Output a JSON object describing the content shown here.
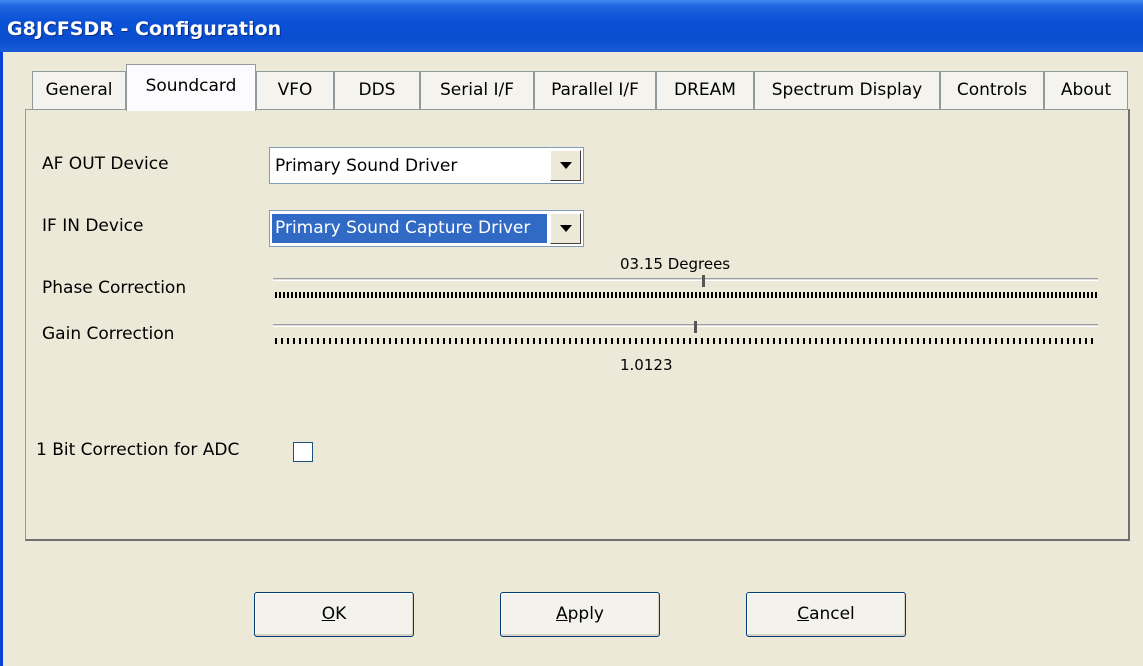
{
  "window": {
    "title": "G8JCFSDR - Configuration"
  },
  "tabs": [
    {
      "label": "General"
    },
    {
      "label": "Soundcard"
    },
    {
      "label": "VFO"
    },
    {
      "label": "DDS"
    },
    {
      "label": "Serial I/F"
    },
    {
      "label": "Parallel I/F"
    },
    {
      "label": "DREAM"
    },
    {
      "label": "Spectrum Display"
    },
    {
      "label": "Controls"
    },
    {
      "label": "About"
    }
  ],
  "active_tab": "Soundcard",
  "soundcard": {
    "af_out": {
      "label": "AF OUT Device",
      "value": "Primary Sound Driver"
    },
    "if_in": {
      "label": "IF IN Device",
      "value": "Primary Sound Capture Driver"
    },
    "phase": {
      "label": "Phase Correction",
      "readout": "03.15 Degrees",
      "position_fraction": 0.52
    },
    "gain": {
      "label": "Gain Correction",
      "readout": "1.0123",
      "position_fraction": 0.51
    },
    "one_bit": {
      "label": "1 Bit Correction for ADC",
      "checked": false
    }
  },
  "buttons": {
    "ok": {
      "mnemonic": "O",
      "rest": "K"
    },
    "apply": {
      "mnemonic": "A",
      "rest": "pply"
    },
    "cancel": {
      "mnemonic": "C",
      "rest": "ancel"
    }
  },
  "colors": {
    "titlebar": "#0a4ecf",
    "selection": "#316ac5",
    "face": "#ece9d8"
  }
}
